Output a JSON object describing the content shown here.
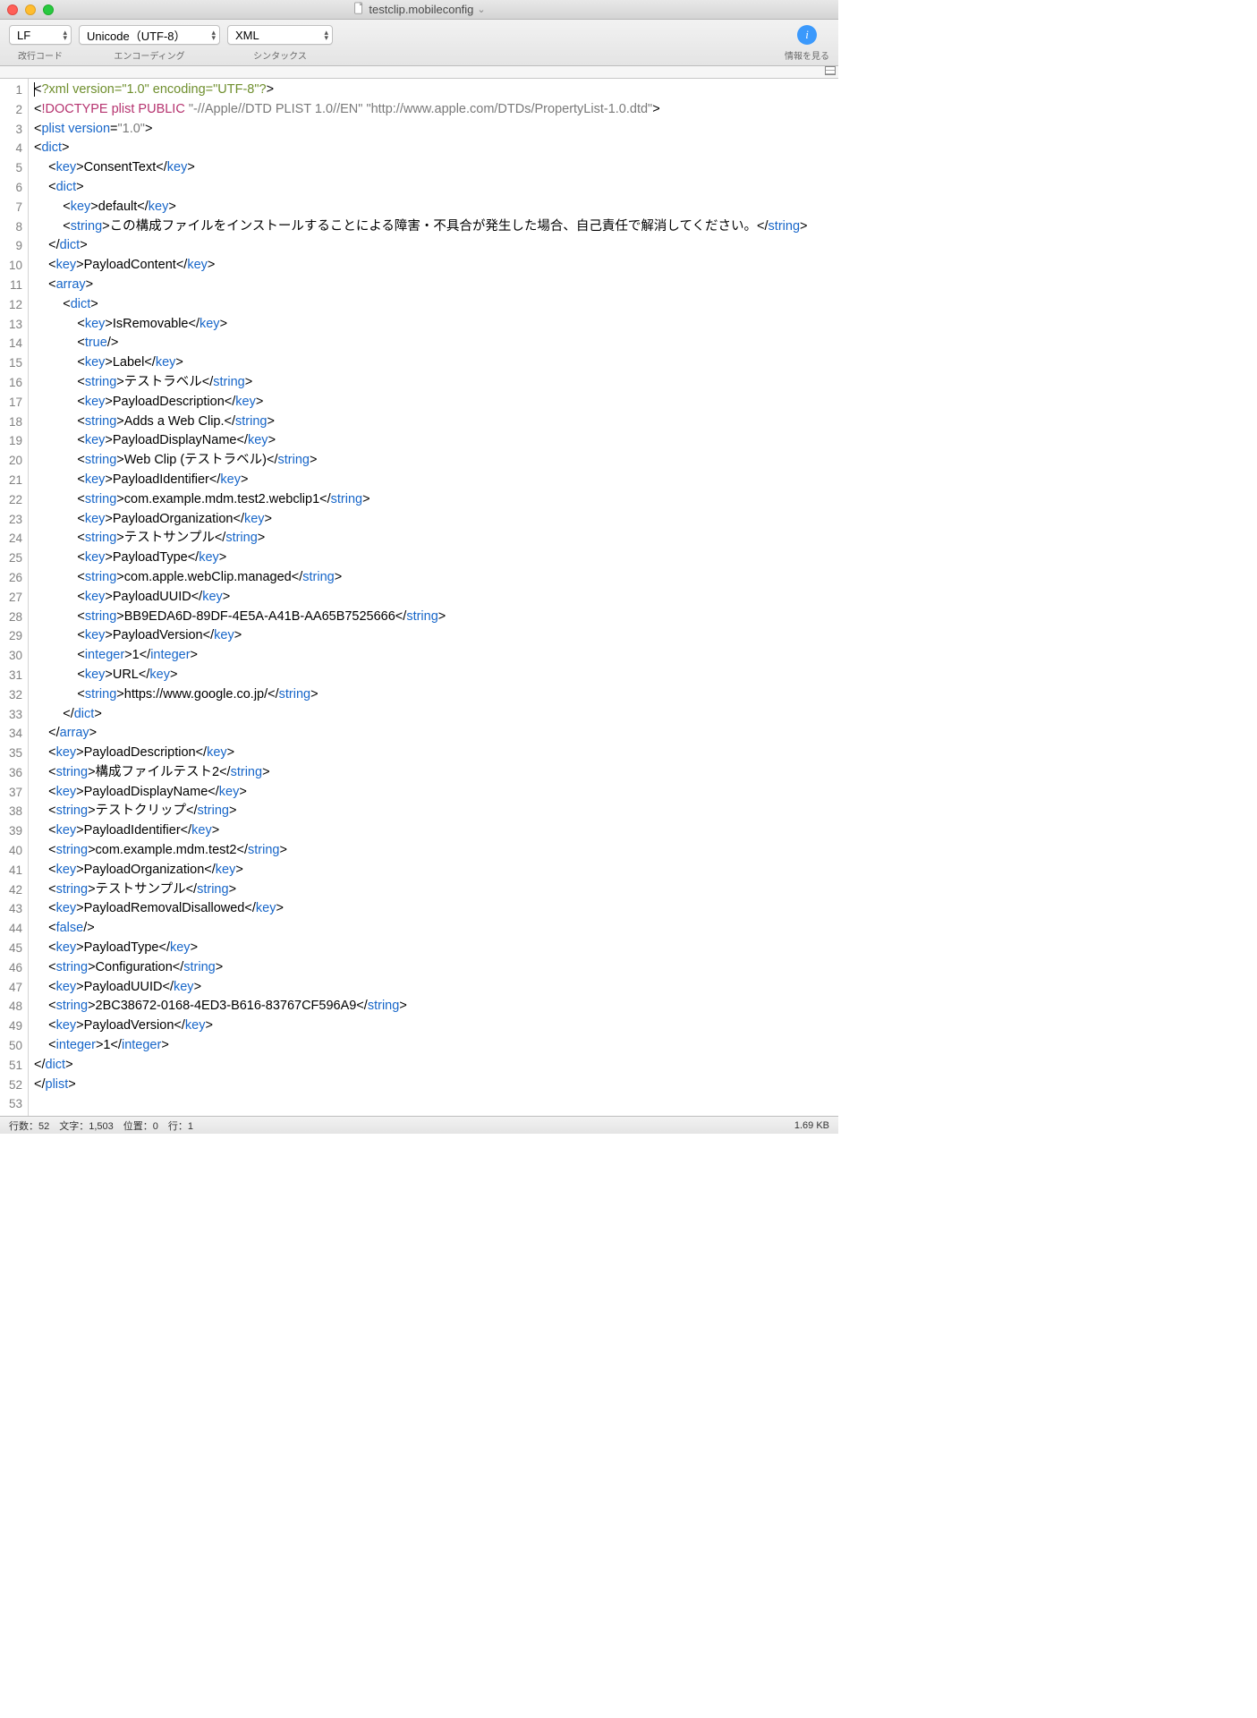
{
  "titlebar": {
    "filename": "testclip.mobileconfig",
    "chevron": "⌄"
  },
  "toolbar": {
    "line_ending": {
      "value": "LF",
      "label": "改行コード"
    },
    "encoding": {
      "value": "Unicode（UTF-8）",
      "label": "エンコーディング"
    },
    "syntax": {
      "value": "XML",
      "label": "シンタックス"
    },
    "info": {
      "glyph": "i",
      "label": "情報を見る"
    }
  },
  "syntax_colors": {
    "xml_declaration": "#6f8f2e",
    "doctype": "#b63470",
    "tag": "#1766c9",
    "attr_value": "#7a7a7a",
    "text": "#000000"
  },
  "code": {
    "total_lines": 53,
    "lines": [
      [
        {
          "c": "c-black",
          "t": "<"
        },
        {
          "c": "c-green",
          "t": "?xml version=\"1.0\" encoding=\"UTF-8\"?"
        },
        {
          "c": "c-black",
          "t": ">"
        }
      ],
      [
        {
          "c": "c-black",
          "t": "<"
        },
        {
          "c": "c-pink",
          "t": "!DOCTYPE plist PUBLIC "
        },
        {
          "c": "c-grey",
          "t": "\"-//Apple//DTD PLIST 1.0//EN\" \"http://www.apple.com/DTDs/PropertyList-1.0.dtd\""
        },
        {
          "c": "c-black",
          "t": ">"
        }
      ],
      [
        {
          "c": "c-black",
          "t": "<"
        },
        {
          "c": "c-blue",
          "t": "plist version"
        },
        {
          "c": "c-black",
          "t": "="
        },
        {
          "c": "c-grey",
          "t": "\"1.0\""
        },
        {
          "c": "c-black",
          "t": ">"
        }
      ],
      [
        {
          "c": "c-black",
          "t": "<"
        },
        {
          "c": "c-blue",
          "t": "dict"
        },
        {
          "c": "c-black",
          "t": ">"
        }
      ],
      [
        {
          "c": "c-black",
          "t": "    <"
        },
        {
          "c": "c-blue",
          "t": "key"
        },
        {
          "c": "c-black",
          "t": ">ConsentText</"
        },
        {
          "c": "c-blue",
          "t": "key"
        },
        {
          "c": "c-black",
          "t": ">"
        }
      ],
      [
        {
          "c": "c-black",
          "t": "    <"
        },
        {
          "c": "c-blue",
          "t": "dict"
        },
        {
          "c": "c-black",
          "t": ">"
        }
      ],
      [
        {
          "c": "c-black",
          "t": "        <"
        },
        {
          "c": "c-blue",
          "t": "key"
        },
        {
          "c": "c-black",
          "t": ">default</"
        },
        {
          "c": "c-blue",
          "t": "key"
        },
        {
          "c": "c-black",
          "t": ">"
        }
      ],
      [
        {
          "c": "c-black",
          "t": "        <"
        },
        {
          "c": "c-blue",
          "t": "string"
        },
        {
          "c": "c-black",
          "t": ">この構成ファイルをインストールすることによる障害・不具合が発生した場合、自己責任で解消してください。</"
        },
        {
          "c": "c-blue",
          "t": "string"
        },
        {
          "c": "c-black",
          "t": ">"
        }
      ],
      [
        {
          "c": "c-black",
          "t": "    </"
        },
        {
          "c": "c-blue",
          "t": "dict"
        },
        {
          "c": "c-black",
          "t": ">"
        }
      ],
      [
        {
          "c": "c-black",
          "t": "    <"
        },
        {
          "c": "c-blue",
          "t": "key"
        },
        {
          "c": "c-black",
          "t": ">PayloadContent</"
        },
        {
          "c": "c-blue",
          "t": "key"
        },
        {
          "c": "c-black",
          "t": ">"
        }
      ],
      [
        {
          "c": "c-black",
          "t": "    <"
        },
        {
          "c": "c-blue",
          "t": "array"
        },
        {
          "c": "c-black",
          "t": ">"
        }
      ],
      [
        {
          "c": "c-black",
          "t": "        <"
        },
        {
          "c": "c-blue",
          "t": "dict"
        },
        {
          "c": "c-black",
          "t": ">"
        }
      ],
      [
        {
          "c": "c-black",
          "t": "            <"
        },
        {
          "c": "c-blue",
          "t": "key"
        },
        {
          "c": "c-black",
          "t": ">IsRemovable</"
        },
        {
          "c": "c-blue",
          "t": "key"
        },
        {
          "c": "c-black",
          "t": ">"
        }
      ],
      [
        {
          "c": "c-black",
          "t": "            <"
        },
        {
          "c": "c-blue",
          "t": "true"
        },
        {
          "c": "c-black",
          "t": "/>"
        }
      ],
      [
        {
          "c": "c-black",
          "t": "            <"
        },
        {
          "c": "c-blue",
          "t": "key"
        },
        {
          "c": "c-black",
          "t": ">Label</"
        },
        {
          "c": "c-blue",
          "t": "key"
        },
        {
          "c": "c-black",
          "t": ">"
        }
      ],
      [
        {
          "c": "c-black",
          "t": "            <"
        },
        {
          "c": "c-blue",
          "t": "string"
        },
        {
          "c": "c-black",
          "t": ">テストラベル</"
        },
        {
          "c": "c-blue",
          "t": "string"
        },
        {
          "c": "c-black",
          "t": ">"
        }
      ],
      [
        {
          "c": "c-black",
          "t": "            <"
        },
        {
          "c": "c-blue",
          "t": "key"
        },
        {
          "c": "c-black",
          "t": ">PayloadDescription</"
        },
        {
          "c": "c-blue",
          "t": "key"
        },
        {
          "c": "c-black",
          "t": ">"
        }
      ],
      [
        {
          "c": "c-black",
          "t": "            <"
        },
        {
          "c": "c-blue",
          "t": "string"
        },
        {
          "c": "c-black",
          "t": ">Adds a Web Clip.</"
        },
        {
          "c": "c-blue",
          "t": "string"
        },
        {
          "c": "c-black",
          "t": ">"
        }
      ],
      [
        {
          "c": "c-black",
          "t": "            <"
        },
        {
          "c": "c-blue",
          "t": "key"
        },
        {
          "c": "c-black",
          "t": ">PayloadDisplayName</"
        },
        {
          "c": "c-blue",
          "t": "key"
        },
        {
          "c": "c-black",
          "t": ">"
        }
      ],
      [
        {
          "c": "c-black",
          "t": "            <"
        },
        {
          "c": "c-blue",
          "t": "string"
        },
        {
          "c": "c-black",
          "t": ">Web Clip (テストラベル)</"
        },
        {
          "c": "c-blue",
          "t": "string"
        },
        {
          "c": "c-black",
          "t": ">"
        }
      ],
      [
        {
          "c": "c-black",
          "t": "            <"
        },
        {
          "c": "c-blue",
          "t": "key"
        },
        {
          "c": "c-black",
          "t": ">PayloadIdentifier</"
        },
        {
          "c": "c-blue",
          "t": "key"
        },
        {
          "c": "c-black",
          "t": ">"
        }
      ],
      [
        {
          "c": "c-black",
          "t": "            <"
        },
        {
          "c": "c-blue",
          "t": "string"
        },
        {
          "c": "c-black",
          "t": ">com.example.mdm.test2.webclip1</"
        },
        {
          "c": "c-blue",
          "t": "string"
        },
        {
          "c": "c-black",
          "t": ">"
        }
      ],
      [
        {
          "c": "c-black",
          "t": "            <"
        },
        {
          "c": "c-blue",
          "t": "key"
        },
        {
          "c": "c-black",
          "t": ">PayloadOrganization</"
        },
        {
          "c": "c-blue",
          "t": "key"
        },
        {
          "c": "c-black",
          "t": ">"
        }
      ],
      [
        {
          "c": "c-black",
          "t": "            <"
        },
        {
          "c": "c-blue",
          "t": "string"
        },
        {
          "c": "c-black",
          "t": ">テストサンプル</"
        },
        {
          "c": "c-blue",
          "t": "string"
        },
        {
          "c": "c-black",
          "t": ">"
        }
      ],
      [
        {
          "c": "c-black",
          "t": "            <"
        },
        {
          "c": "c-blue",
          "t": "key"
        },
        {
          "c": "c-black",
          "t": ">PayloadType</"
        },
        {
          "c": "c-blue",
          "t": "key"
        },
        {
          "c": "c-black",
          "t": ">"
        }
      ],
      [
        {
          "c": "c-black",
          "t": "            <"
        },
        {
          "c": "c-blue",
          "t": "string"
        },
        {
          "c": "c-black",
          "t": ">com.apple.webClip.managed</"
        },
        {
          "c": "c-blue",
          "t": "string"
        },
        {
          "c": "c-black",
          "t": ">"
        }
      ],
      [
        {
          "c": "c-black",
          "t": "            <"
        },
        {
          "c": "c-blue",
          "t": "key"
        },
        {
          "c": "c-black",
          "t": ">PayloadUUID</"
        },
        {
          "c": "c-blue",
          "t": "key"
        },
        {
          "c": "c-black",
          "t": ">"
        }
      ],
      [
        {
          "c": "c-black",
          "t": "            <"
        },
        {
          "c": "c-blue",
          "t": "string"
        },
        {
          "c": "c-black",
          "t": ">BB9EDA6D-89DF-4E5A-A41B-AA65B7525666</"
        },
        {
          "c": "c-blue",
          "t": "string"
        },
        {
          "c": "c-black",
          "t": ">"
        }
      ],
      [
        {
          "c": "c-black",
          "t": "            <"
        },
        {
          "c": "c-blue",
          "t": "key"
        },
        {
          "c": "c-black",
          "t": ">PayloadVersion</"
        },
        {
          "c": "c-blue",
          "t": "key"
        },
        {
          "c": "c-black",
          "t": ">"
        }
      ],
      [
        {
          "c": "c-black",
          "t": "            <"
        },
        {
          "c": "c-blue",
          "t": "integer"
        },
        {
          "c": "c-black",
          "t": ">1</"
        },
        {
          "c": "c-blue",
          "t": "integer"
        },
        {
          "c": "c-black",
          "t": ">"
        }
      ],
      [
        {
          "c": "c-black",
          "t": "            <"
        },
        {
          "c": "c-blue",
          "t": "key"
        },
        {
          "c": "c-black",
          "t": ">URL</"
        },
        {
          "c": "c-blue",
          "t": "key"
        },
        {
          "c": "c-black",
          "t": ">"
        }
      ],
      [
        {
          "c": "c-black",
          "t": "            <"
        },
        {
          "c": "c-blue",
          "t": "string"
        },
        {
          "c": "c-black",
          "t": ">https://www.google.co.jp/</"
        },
        {
          "c": "c-blue",
          "t": "string"
        },
        {
          "c": "c-black",
          "t": ">"
        }
      ],
      [
        {
          "c": "c-black",
          "t": "        </"
        },
        {
          "c": "c-blue",
          "t": "dict"
        },
        {
          "c": "c-black",
          "t": ">"
        }
      ],
      [
        {
          "c": "c-black",
          "t": "    </"
        },
        {
          "c": "c-blue",
          "t": "array"
        },
        {
          "c": "c-black",
          "t": ">"
        }
      ],
      [
        {
          "c": "c-black",
          "t": "    <"
        },
        {
          "c": "c-blue",
          "t": "key"
        },
        {
          "c": "c-black",
          "t": ">PayloadDescription</"
        },
        {
          "c": "c-blue",
          "t": "key"
        },
        {
          "c": "c-black",
          "t": ">"
        }
      ],
      [
        {
          "c": "c-black",
          "t": "    <"
        },
        {
          "c": "c-blue",
          "t": "string"
        },
        {
          "c": "c-black",
          "t": ">構成ファイルテスト2</"
        },
        {
          "c": "c-blue",
          "t": "string"
        },
        {
          "c": "c-black",
          "t": ">"
        }
      ],
      [
        {
          "c": "c-black",
          "t": "    <"
        },
        {
          "c": "c-blue",
          "t": "key"
        },
        {
          "c": "c-black",
          "t": ">PayloadDisplayName</"
        },
        {
          "c": "c-blue",
          "t": "key"
        },
        {
          "c": "c-black",
          "t": ">"
        }
      ],
      [
        {
          "c": "c-black",
          "t": "    <"
        },
        {
          "c": "c-blue",
          "t": "string"
        },
        {
          "c": "c-black",
          "t": ">テストクリップ</"
        },
        {
          "c": "c-blue",
          "t": "string"
        },
        {
          "c": "c-black",
          "t": ">"
        }
      ],
      [
        {
          "c": "c-black",
          "t": "    <"
        },
        {
          "c": "c-blue",
          "t": "key"
        },
        {
          "c": "c-black",
          "t": ">PayloadIdentifier</"
        },
        {
          "c": "c-blue",
          "t": "key"
        },
        {
          "c": "c-black",
          "t": ">"
        }
      ],
      [
        {
          "c": "c-black",
          "t": "    <"
        },
        {
          "c": "c-blue",
          "t": "string"
        },
        {
          "c": "c-black",
          "t": ">com.example.mdm.test2</"
        },
        {
          "c": "c-blue",
          "t": "string"
        },
        {
          "c": "c-black",
          "t": ">"
        }
      ],
      [
        {
          "c": "c-black",
          "t": "    <"
        },
        {
          "c": "c-blue",
          "t": "key"
        },
        {
          "c": "c-black",
          "t": ">PayloadOrganization</"
        },
        {
          "c": "c-blue",
          "t": "key"
        },
        {
          "c": "c-black",
          "t": ">"
        }
      ],
      [
        {
          "c": "c-black",
          "t": "    <"
        },
        {
          "c": "c-blue",
          "t": "string"
        },
        {
          "c": "c-black",
          "t": ">テストサンプル</"
        },
        {
          "c": "c-blue",
          "t": "string"
        },
        {
          "c": "c-black",
          "t": ">"
        }
      ],
      [
        {
          "c": "c-black",
          "t": "    <"
        },
        {
          "c": "c-blue",
          "t": "key"
        },
        {
          "c": "c-black",
          "t": ">PayloadRemovalDisallowed</"
        },
        {
          "c": "c-blue",
          "t": "key"
        },
        {
          "c": "c-black",
          "t": ">"
        }
      ],
      [
        {
          "c": "c-black",
          "t": "    <"
        },
        {
          "c": "c-blue",
          "t": "false"
        },
        {
          "c": "c-black",
          "t": "/>"
        }
      ],
      [
        {
          "c": "c-black",
          "t": "    <"
        },
        {
          "c": "c-blue",
          "t": "key"
        },
        {
          "c": "c-black",
          "t": ">PayloadType</"
        },
        {
          "c": "c-blue",
          "t": "key"
        },
        {
          "c": "c-black",
          "t": ">"
        }
      ],
      [
        {
          "c": "c-black",
          "t": "    <"
        },
        {
          "c": "c-blue",
          "t": "string"
        },
        {
          "c": "c-black",
          "t": ">Configuration</"
        },
        {
          "c": "c-blue",
          "t": "string"
        },
        {
          "c": "c-black",
          "t": ">"
        }
      ],
      [
        {
          "c": "c-black",
          "t": "    <"
        },
        {
          "c": "c-blue",
          "t": "key"
        },
        {
          "c": "c-black",
          "t": ">PayloadUUID</"
        },
        {
          "c": "c-blue",
          "t": "key"
        },
        {
          "c": "c-black",
          "t": ">"
        }
      ],
      [
        {
          "c": "c-black",
          "t": "    <"
        },
        {
          "c": "c-blue",
          "t": "string"
        },
        {
          "c": "c-black",
          "t": ">2BC38672-0168-4ED3-B616-83767CF596A9</"
        },
        {
          "c": "c-blue",
          "t": "string"
        },
        {
          "c": "c-black",
          "t": ">"
        }
      ],
      [
        {
          "c": "c-black",
          "t": "    <"
        },
        {
          "c": "c-blue",
          "t": "key"
        },
        {
          "c": "c-black",
          "t": ">PayloadVersion</"
        },
        {
          "c": "c-blue",
          "t": "key"
        },
        {
          "c": "c-black",
          "t": ">"
        }
      ],
      [
        {
          "c": "c-black",
          "t": "    <"
        },
        {
          "c": "c-blue",
          "t": "integer"
        },
        {
          "c": "c-black",
          "t": ">1</"
        },
        {
          "c": "c-blue",
          "t": "integer"
        },
        {
          "c": "c-black",
          "t": ">"
        }
      ],
      [
        {
          "c": "c-black",
          "t": "</"
        },
        {
          "c": "c-blue",
          "t": "dict"
        },
        {
          "c": "c-black",
          "t": ">"
        }
      ],
      [
        {
          "c": "c-black",
          "t": "</"
        },
        {
          "c": "c-blue",
          "t": "plist"
        },
        {
          "c": "c-black",
          "t": ">"
        }
      ],
      [
        {
          "c": "c-black",
          "t": ""
        }
      ]
    ]
  },
  "statusbar": {
    "left": "行数：52　文字：1,503　位置：0　行：1",
    "right": "1.69 KB"
  }
}
